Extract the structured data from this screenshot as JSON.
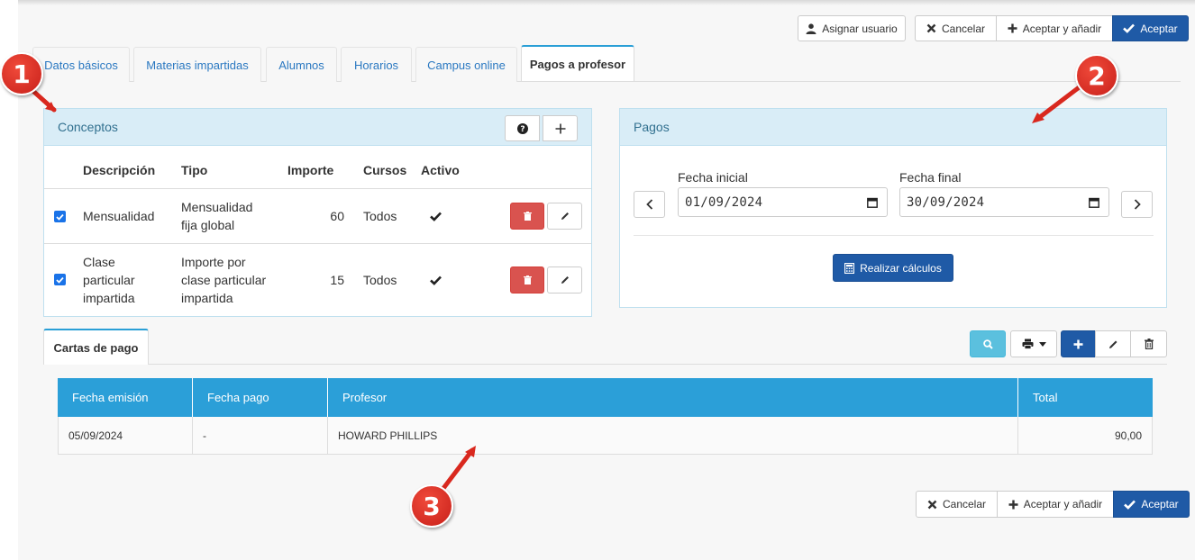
{
  "top_actions": {
    "assign_user": "Asignar usuario",
    "cancel": "Cancelar",
    "accept_add": "Aceptar y añadir",
    "accept": "Aceptar"
  },
  "tabs": [
    "Datos básicos",
    "Materias impartidas",
    "Alumnos",
    "Horarios",
    "Campus online",
    "Pagos a profesor"
  ],
  "active_tab": "Pagos a profesor",
  "conceptos": {
    "title": "Conceptos",
    "headers": [
      "Descripción",
      "Tipo",
      "Importe",
      "Cursos",
      "Activo"
    ],
    "rows": [
      {
        "checked": true,
        "descripcion": "Mensualidad",
        "tipo": "Mensualidad fija global",
        "importe": "60",
        "cursos": "Todos",
        "activo": true
      },
      {
        "checked": true,
        "descripcion": "Clase particular impartida",
        "tipo": "Importe por clase particular impartida",
        "importe": "15",
        "cursos": "Todos",
        "activo": true
      }
    ]
  },
  "pagos": {
    "title": "Pagos",
    "start_label": "Fecha inicial",
    "start_value": "01/09/2024",
    "end_label": "Fecha final",
    "end_value": "30/09/2024",
    "calc_button": "Realizar cálculos"
  },
  "cartas": {
    "tab": "Cartas de pago",
    "headers": [
      "Fecha emisión",
      "Fecha pago",
      "Profesor",
      "Total"
    ],
    "rows": [
      {
        "fecha_emision": "05/09/2024",
        "fecha_pago": "-",
        "profesor": "HOWARD PHILLIPS",
        "total": "90,00"
      }
    ]
  },
  "bottom_actions": {
    "cancel": "Cancelar",
    "accept_add": "Aceptar y añadir",
    "accept": "Aceptar"
  },
  "markers": [
    "1",
    "2",
    "3"
  ],
  "colors": {
    "primary": "#1f5aa6",
    "info": "#2b9fd8",
    "danger": "#d9534f",
    "marker": "#d9281e"
  }
}
